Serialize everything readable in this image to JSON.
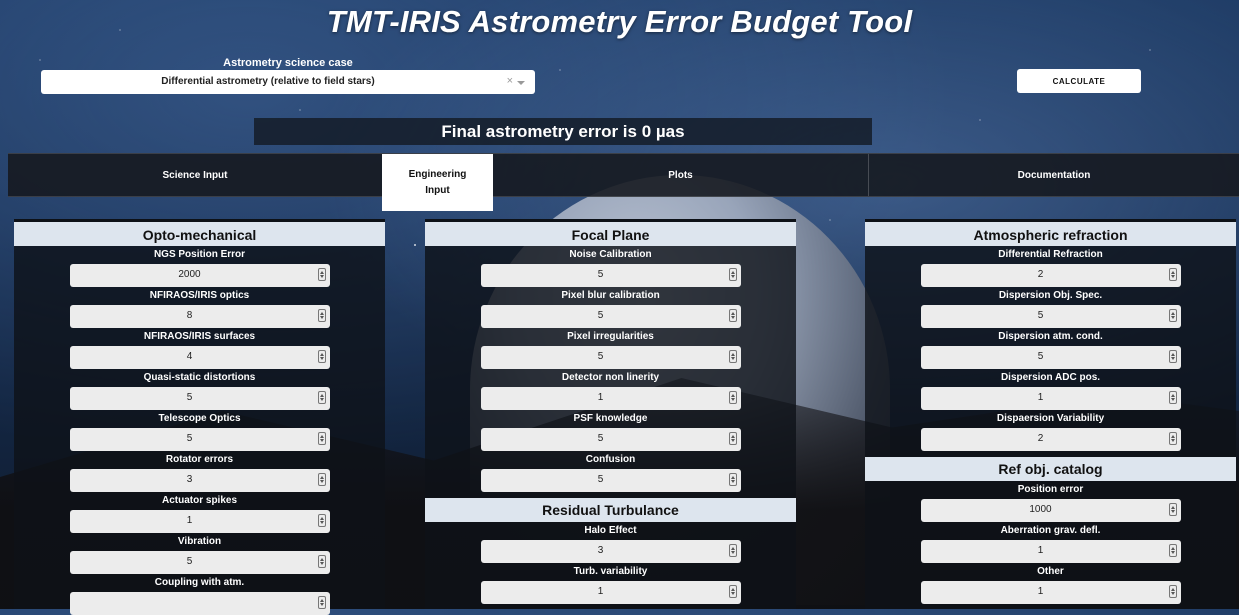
{
  "app": {
    "title": "TMT-IRIS Astrometry Error Budget Tool"
  },
  "science_case": {
    "label": "Astrometry science case",
    "selected": "Differential astrometry (relative to field stars)",
    "clear_glyph": "×"
  },
  "calculate_label": "CALCULATE",
  "final_error": "Final astrometry error is 0 µas",
  "tabs": [
    {
      "label": "Science Input"
    },
    {
      "label": "Engineering Input"
    },
    {
      "label": "Plots"
    },
    {
      "label": "Documentation"
    }
  ],
  "panels": {
    "opto": {
      "title": "Opto-mechanical",
      "fields": [
        {
          "label": "NGS Position Error",
          "value": "2000"
        },
        {
          "label": "NFIRAOS/IRIS optics",
          "value": "8"
        },
        {
          "label": "NFIRAOS/IRIS surfaces",
          "value": "4"
        },
        {
          "label": "Quasi-static distortions",
          "value": "5"
        },
        {
          "label": "Telescope Optics",
          "value": "5"
        },
        {
          "label": "Rotator errors",
          "value": "3"
        },
        {
          "label": "Actuator spikes",
          "value": "1"
        },
        {
          "label": "Vibration",
          "value": "5"
        },
        {
          "label": "Coupling with atm.",
          "value": ""
        }
      ]
    },
    "focal": {
      "title": "Focal Plane",
      "fields": [
        {
          "label": "Noise Calibration",
          "value": "5"
        },
        {
          "label": "Pixel blur calibration",
          "value": "5"
        },
        {
          "label": "Pixel irregularities",
          "value": "5"
        },
        {
          "label": "Detector non linerity",
          "value": "1"
        },
        {
          "label": "PSF knowledge",
          "value": "5"
        },
        {
          "label": "Confusion",
          "value": "5"
        }
      ]
    },
    "residual": {
      "title": "Residual Turbulance",
      "fields": [
        {
          "label": "Halo Effect",
          "value": "3"
        },
        {
          "label": "Turb. variability",
          "value": "1"
        }
      ]
    },
    "atmo": {
      "title": "Atmospheric refraction",
      "fields": [
        {
          "label": "Differential Refraction",
          "value": "2"
        },
        {
          "label": "Dispersion Obj. Spec.",
          "value": "5"
        },
        {
          "label": "Dispersion atm. cond.",
          "value": "5"
        },
        {
          "label": "Dispersion ADC pos.",
          "value": "1"
        },
        {
          "label": "Dispaersion Variability",
          "value": "2"
        }
      ]
    },
    "ref": {
      "title": "Ref obj. catalog",
      "fields": [
        {
          "label": "Position error",
          "value": "1000"
        },
        {
          "label": "Aberration grav. defl.",
          "value": "1"
        },
        {
          "label": "Other",
          "value": "1"
        }
      ]
    }
  }
}
